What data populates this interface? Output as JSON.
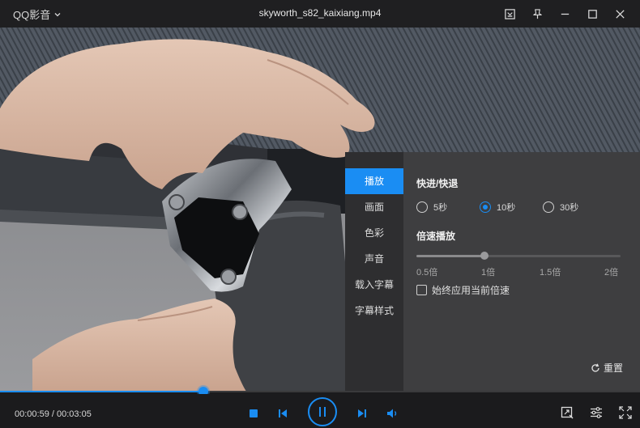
{
  "titlebar": {
    "brand": "QQ影音",
    "filename": "skyworth_s82_kaixiang.mp4"
  },
  "panel": {
    "nav": [
      {
        "label": "播放",
        "active": true
      },
      {
        "label": "画面",
        "active": false
      },
      {
        "label": "色彩",
        "active": false
      },
      {
        "label": "声音",
        "active": false
      },
      {
        "label": "载入字幕",
        "active": false
      },
      {
        "label": "字幕样式",
        "active": false
      }
    ],
    "seek_title": "快进/快退",
    "seek_options": [
      {
        "label": "5秒",
        "checked": false
      },
      {
        "label": "10秒",
        "checked": true
      },
      {
        "label": "30秒",
        "checked": false
      }
    ],
    "speed_title": "倍速播放",
    "speed_ticks": [
      "0.5倍",
      "1倍",
      "1.5倍",
      "2倍"
    ],
    "speed_value": "1倍",
    "speed_fraction": 0.333,
    "always_apply_label": "始终应用当前倍速",
    "always_apply_checked": false,
    "reset_label": "重置"
  },
  "playback": {
    "current_time": "00:00:59",
    "total_time": "00:03:05",
    "time_display": "00:00:59 / 00:03:05",
    "progress_fraction": 0.318
  },
  "colors": {
    "accent": "#1a8df3",
    "panel_bg": "#3e3e40",
    "nav_bg": "#2e2e30",
    "chrome_bg": "#1b1b1d"
  },
  "icons": [
    "chevron-down-icon",
    "screenshot-icon",
    "pin-icon",
    "minimize-icon",
    "maximize-icon",
    "close-icon",
    "reset-icon",
    "stop-icon",
    "previous-icon",
    "pause-icon",
    "next-icon",
    "volume-icon",
    "screen-capture-icon",
    "settings-sliders-icon",
    "fullscreen-icon"
  ]
}
